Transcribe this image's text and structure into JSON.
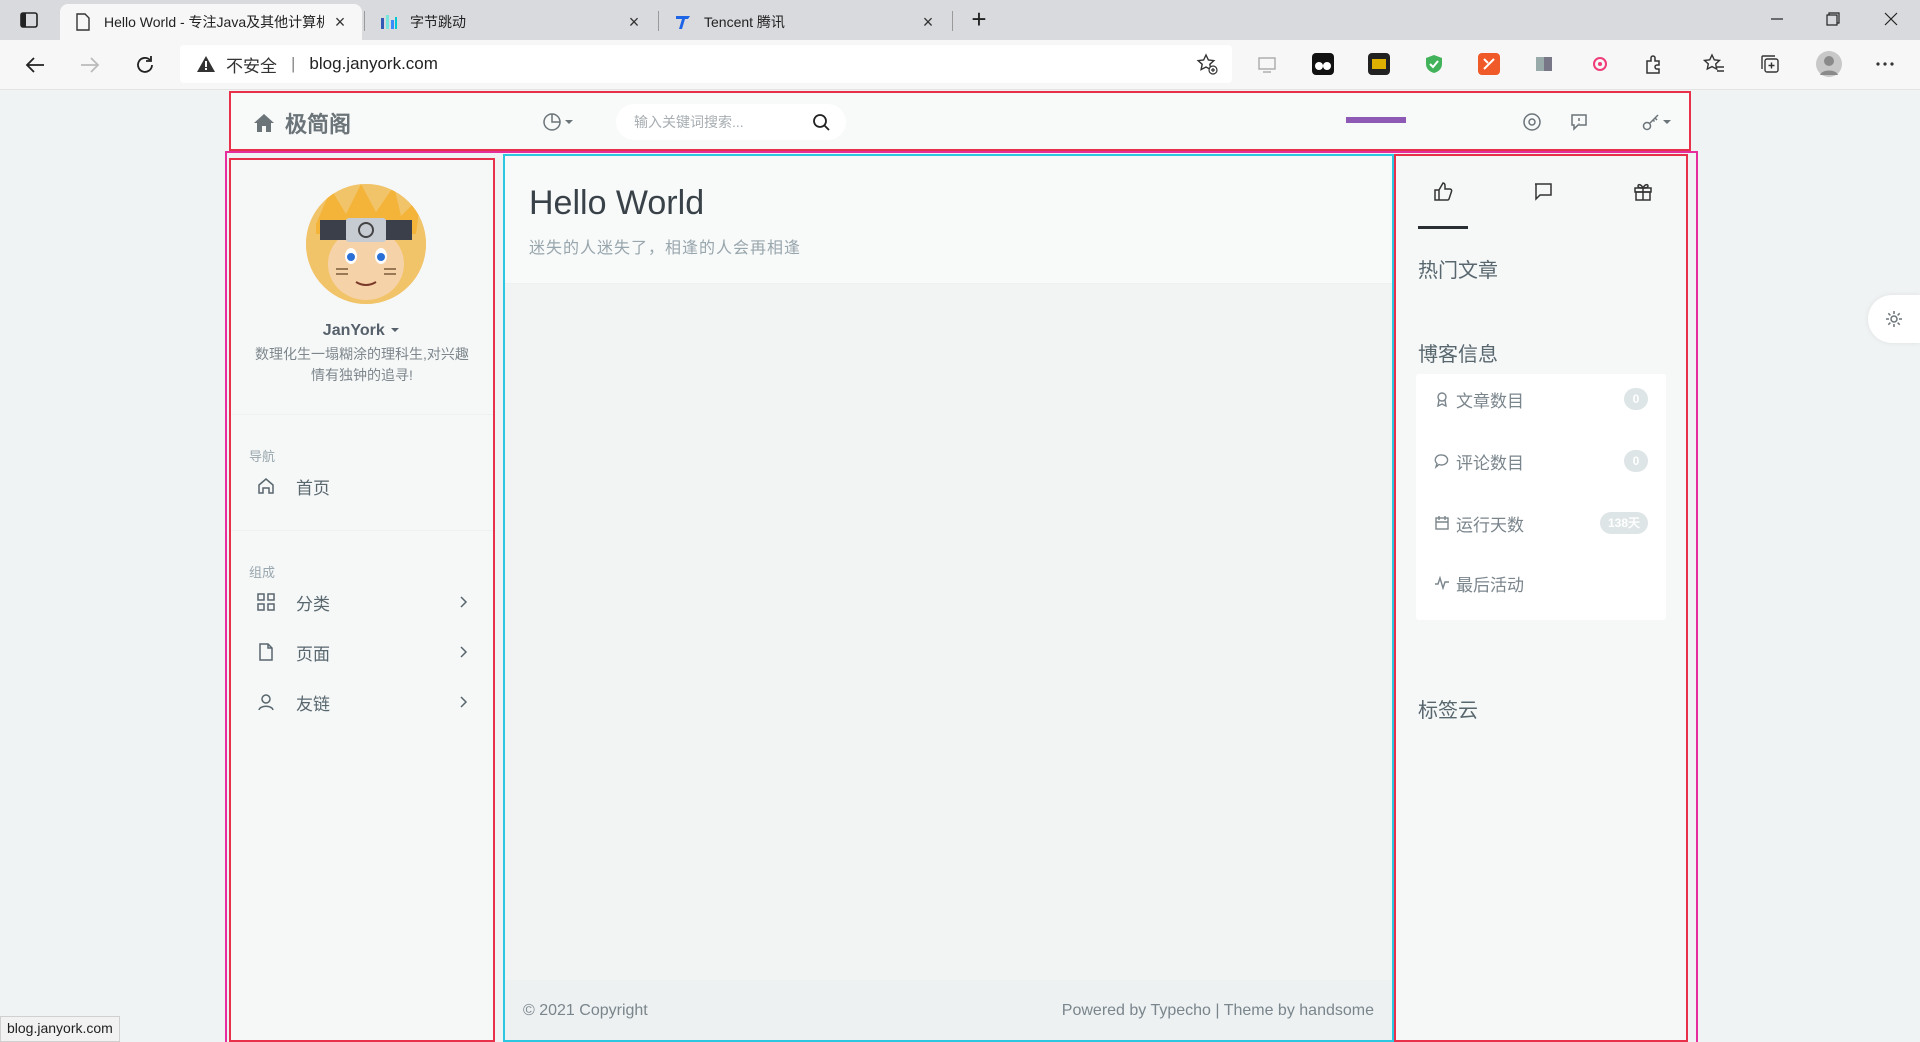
{
  "browser": {
    "tabs": [
      {
        "title": "Hello World - 专注Java及其他计算机技术",
        "active": true
      },
      {
        "title": "字节跳动",
        "active": false
      },
      {
        "title": "Tencent 腾讯",
        "active": false
      }
    ],
    "address": {
      "security_label": "不安全",
      "url": "blog.janyork.com"
    },
    "status_url": "blog.janyork.com"
  },
  "header": {
    "brand": "极简阁",
    "search_placeholder": "输入关键词搜索...",
    "reading_progress": 1.0
  },
  "sidebar": {
    "username": "JanYork",
    "bio": "数理化生一塌糊涂的理科生,对兴趣情有独钟的追寻!",
    "nav_heading": "导航",
    "home_label": "首页",
    "group_heading": "组成",
    "items": [
      {
        "label": "分类",
        "icon": "grid-icon"
      },
      {
        "label": "页面",
        "icon": "file-icon"
      },
      {
        "label": "友链",
        "icon": "user-icon"
      }
    ]
  },
  "main": {
    "title": "Hello World",
    "subtitle": "迷失的人迷失了，相逢的人会再相逢",
    "copyright": "© 2021 Copyright",
    "powered": "Powered by Typecho | Theme by handsome"
  },
  "right": {
    "hot_title": "热门文章",
    "blog_info_title": "博客信息",
    "stats": [
      {
        "label": "文章数目",
        "value": "0",
        "icon": "award-icon"
      },
      {
        "label": "评论数目",
        "value": "0",
        "icon": "comment-icon"
      },
      {
        "label": "运行天数",
        "value": "138天",
        "icon": "calendar-icon"
      },
      {
        "label": "最后活动",
        "value": "",
        "icon": "activity-icon"
      }
    ],
    "tags_title": "标签云"
  },
  "colors": {
    "accent_purple": "#8e59b4",
    "outline_red": "#e8304a",
    "outline_magenta": "#e52e9c",
    "outline_cyan": "#2bc7e0"
  }
}
